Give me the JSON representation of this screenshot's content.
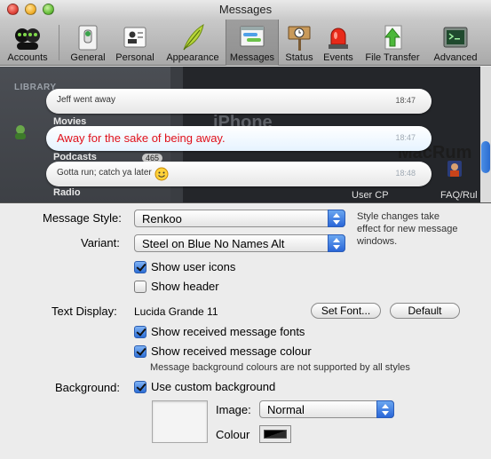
{
  "window": {
    "title": "Messages"
  },
  "toolbar": {
    "items": [
      {
        "label": "Accounts",
        "icon": "accounts-icon"
      },
      {
        "label": "General",
        "icon": "general-switch-icon"
      },
      {
        "label": "Personal",
        "icon": "personal-card-icon"
      },
      {
        "label": "Appearance",
        "icon": "feather-icon"
      },
      {
        "label": "Messages",
        "icon": "messages-window-icon",
        "selected": true
      },
      {
        "label": "Status",
        "icon": "status-sign-icon"
      },
      {
        "label": "Events",
        "icon": "siren-icon"
      },
      {
        "label": "File Transfer",
        "icon": "file-transfer-icon"
      },
      {
        "label": "Advanced",
        "icon": "terminal-icon"
      }
    ]
  },
  "preview": {
    "library_label": "LIBRARY",
    "sidebar_items": [
      "Movies",
      "Podcasts",
      "Radio"
    ],
    "podcast_count": "465",
    "background_text": {
      "iphone": "iPhone",
      "macrumors": "MacRum",
      "user_cp": "User CP",
      "faq": "FAQ/Rul"
    },
    "messages": [
      {
        "text": "Jeff went away",
        "time": "18:47"
      },
      {
        "text": "Away for the sake of being away.",
        "time": "18:47"
      },
      {
        "text": "Gotta run; catch ya later",
        "time": "18:48"
      }
    ]
  },
  "form": {
    "message_style": {
      "label": "Message Style:",
      "value": "Renkoo"
    },
    "style_note": "Style changes take effect for new message windows.",
    "variant": {
      "label": "Variant:",
      "value": "Steel on Blue No Names Alt"
    },
    "show_user_icons": {
      "label": "Show user icons",
      "checked": true
    },
    "show_header": {
      "label": "Show header",
      "checked": false
    },
    "text_display": {
      "label": "Text Display:",
      "value": "Lucida Grande 11"
    },
    "set_font_button": "Set Font...",
    "default_button": "Default",
    "show_received_fonts": {
      "label": "Show received message fonts",
      "checked": true
    },
    "show_received_colour": {
      "label": "Show received message colour",
      "checked": true
    },
    "colour_note": "Message background colours are not supported by all styles",
    "background": {
      "label": "Background:",
      "use_custom": {
        "label": "Use custom background",
        "checked": true
      }
    },
    "image": {
      "label": "Image:",
      "value": "Normal"
    },
    "colour": {
      "label": "Colour",
      "value": "#000000"
    }
  }
}
